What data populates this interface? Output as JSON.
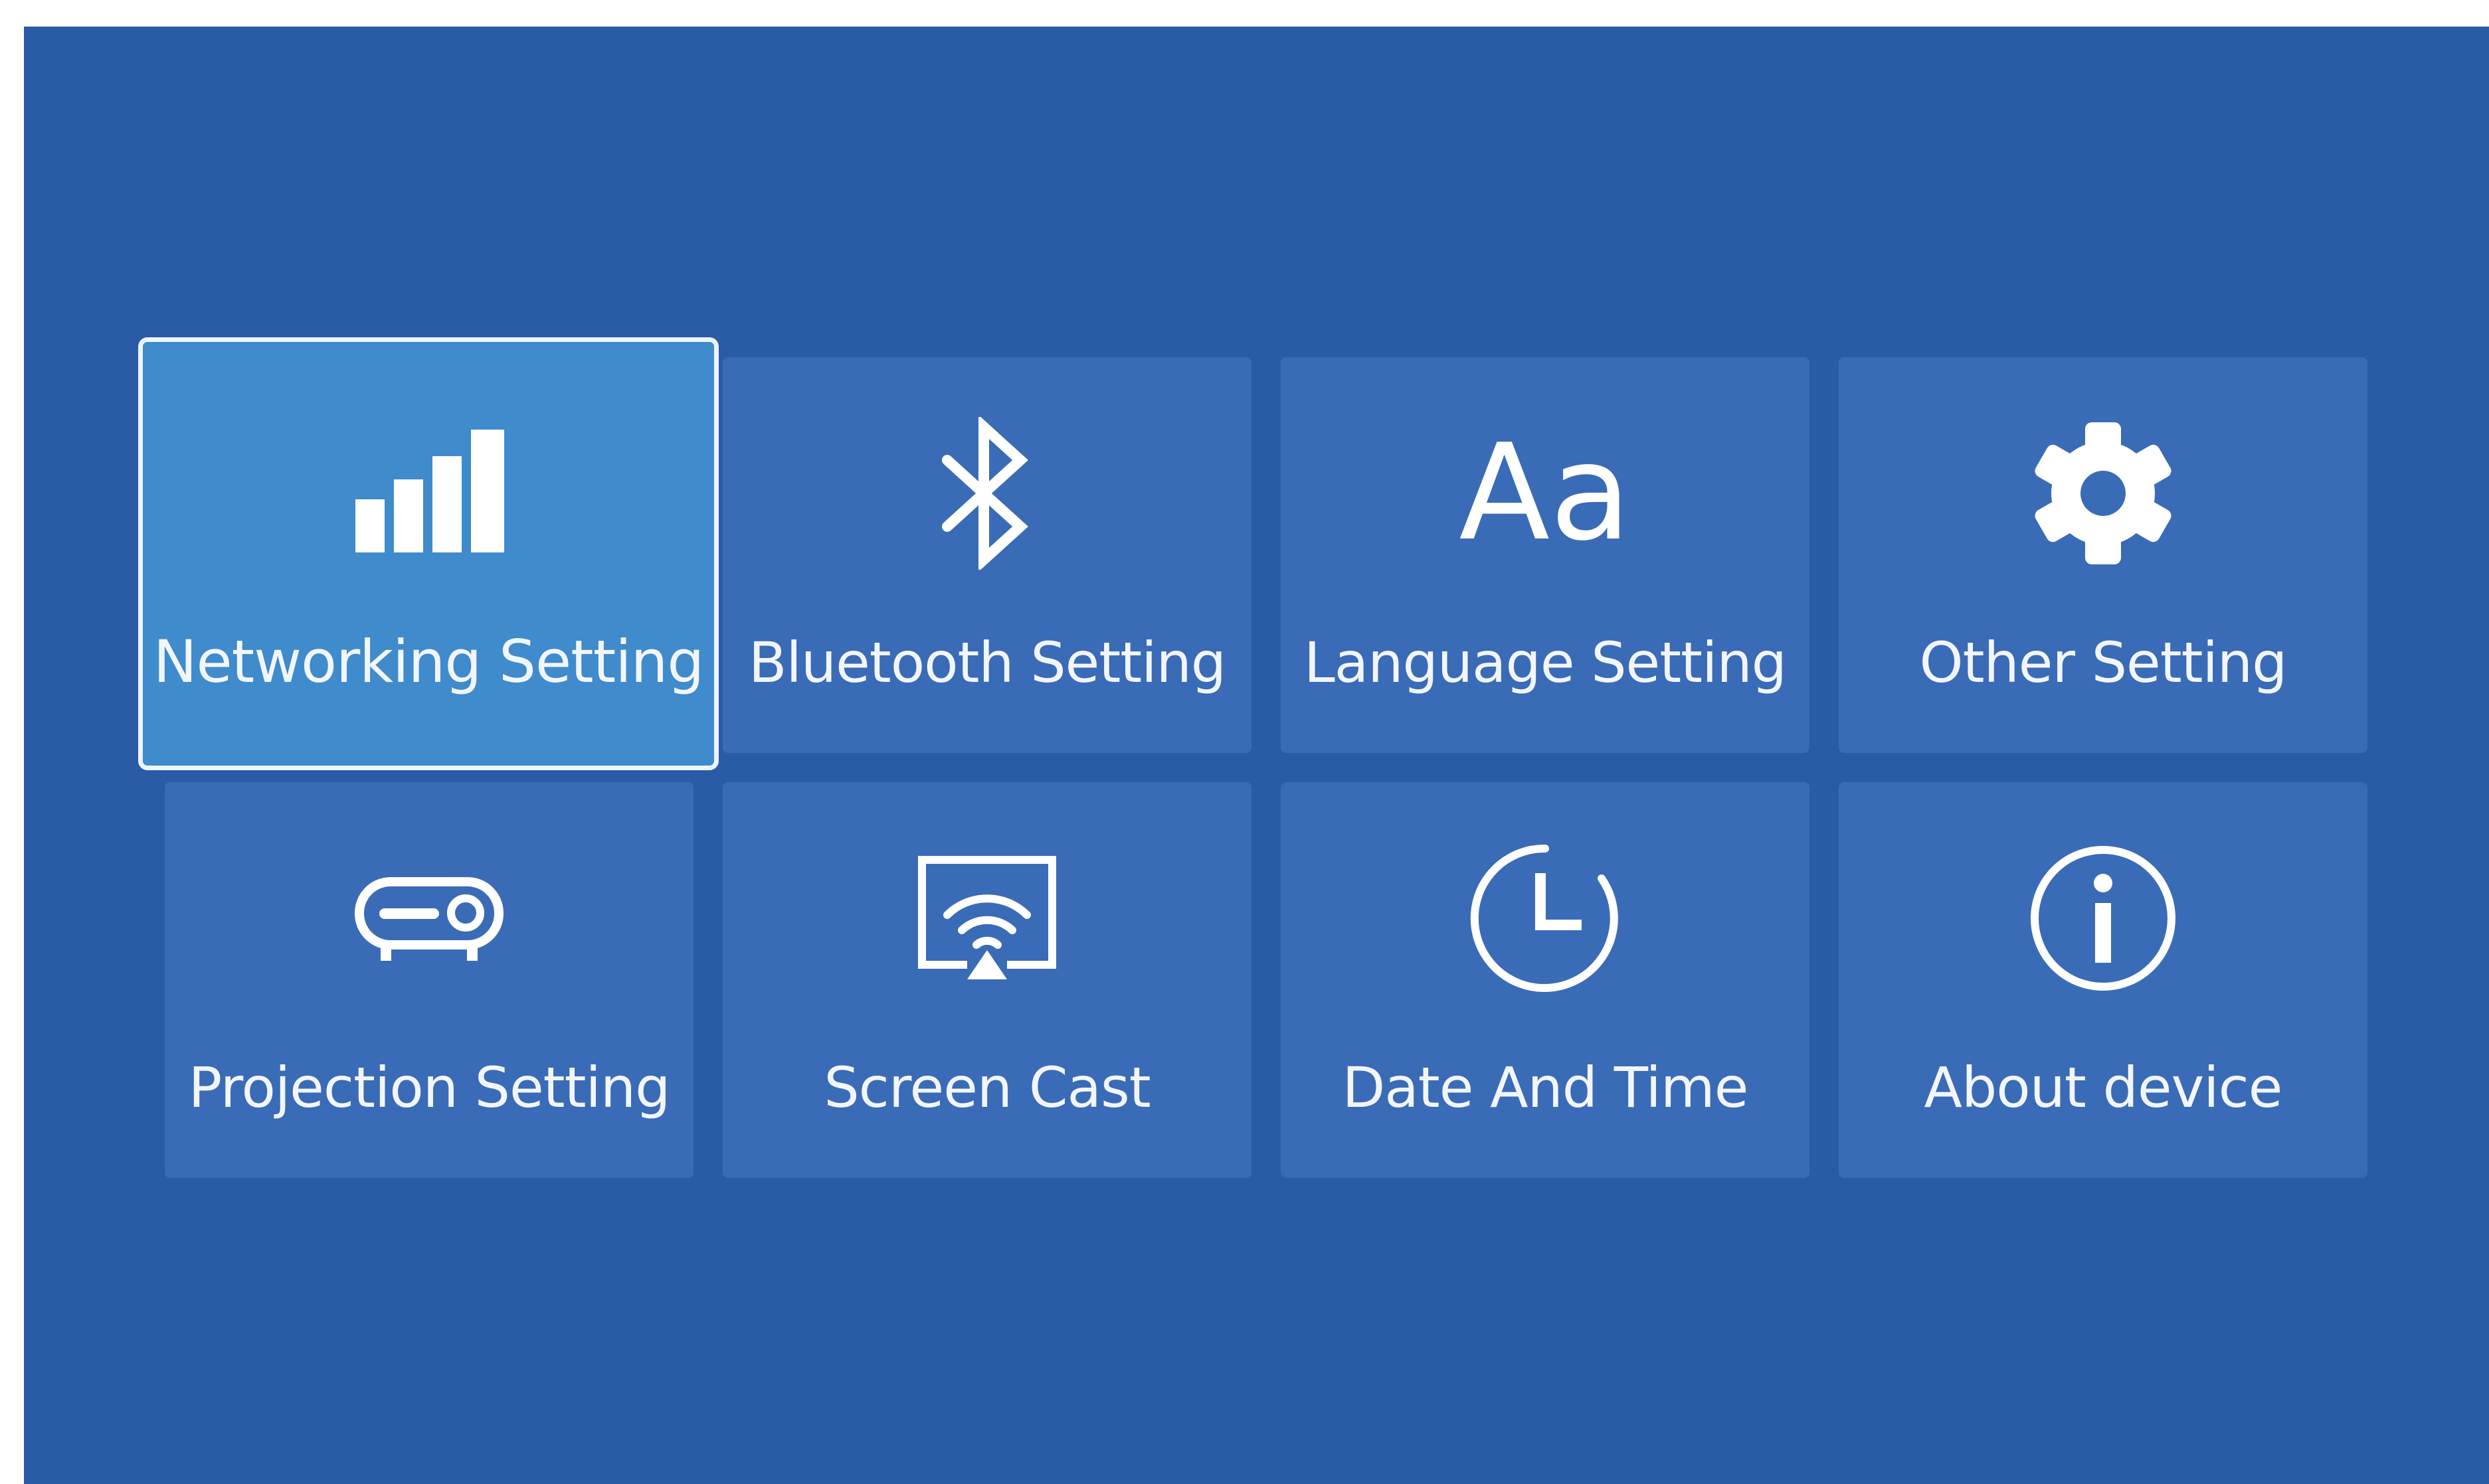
{
  "settings_menu": {
    "items": [
      {
        "label": "Networking Setting",
        "icon": "signal-bars-icon",
        "selected": true
      },
      {
        "label": "Bluetooth Setting",
        "icon": "bluetooth-icon",
        "selected": false
      },
      {
        "label": "Language Setting",
        "icon": "language-aa-icon",
        "selected": false
      },
      {
        "label": "Other Setting",
        "icon": "gear-icon",
        "selected": false
      },
      {
        "label": "Projection Setting",
        "icon": "projector-icon",
        "selected": false
      },
      {
        "label": "Screen Cast",
        "icon": "screen-cast-icon",
        "selected": false
      },
      {
        "label": "Date And Time",
        "icon": "clock-icon",
        "selected": false
      },
      {
        "label": "About device",
        "icon": "info-icon",
        "selected": false
      }
    ],
    "language_icon_glyph": "Aa"
  },
  "colors": {
    "background": "#2a5ba7",
    "tile": "#3a6bb7",
    "tile_selected": "#3f8bcc",
    "selected_border": "#eef5ff",
    "text": "#f2f6fc"
  }
}
